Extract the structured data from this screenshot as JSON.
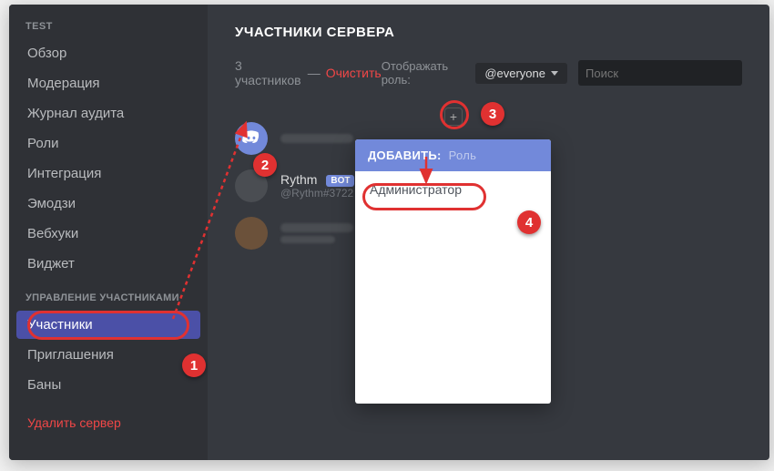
{
  "sidebar": {
    "section1": "TEST",
    "items1": [
      "Обзор",
      "Модерация",
      "Журнал аудита",
      "Роли",
      "Интеграция",
      "Эмодзи",
      "Вебхуки",
      "Виджет"
    ],
    "section2": "УПРАВЛЕНИЕ УЧАСТНИКАМИ",
    "items2": [
      "Участники",
      "Приглашения",
      "Баны"
    ],
    "active": "Участники",
    "delete": "Удалить сервер"
  },
  "main": {
    "title": "УЧАСТНИКИ СЕРВЕРА",
    "count_text": "3 участников",
    "dash": "—",
    "clear": "Очистить",
    "show_role_label": "Отображать роль:",
    "role_value": "@everyone",
    "search_placeholder": "Поиск"
  },
  "members": [
    {
      "name": "",
      "tag": "",
      "blurred": true,
      "avatar": "discord"
    },
    {
      "name": "Rythm",
      "tag": "@Rythm#3722",
      "bot": "BOT",
      "avatar": "gray"
    },
    {
      "name": "",
      "tag": "",
      "blurred": true,
      "avatar": "brown"
    }
  ],
  "popover": {
    "head_label": "ДОБАВИТЬ:",
    "head_hint": "Роль",
    "items": [
      "Администратор"
    ]
  },
  "callouts": {
    "1": "1",
    "2": "2",
    "3": "3",
    "4": "4"
  }
}
